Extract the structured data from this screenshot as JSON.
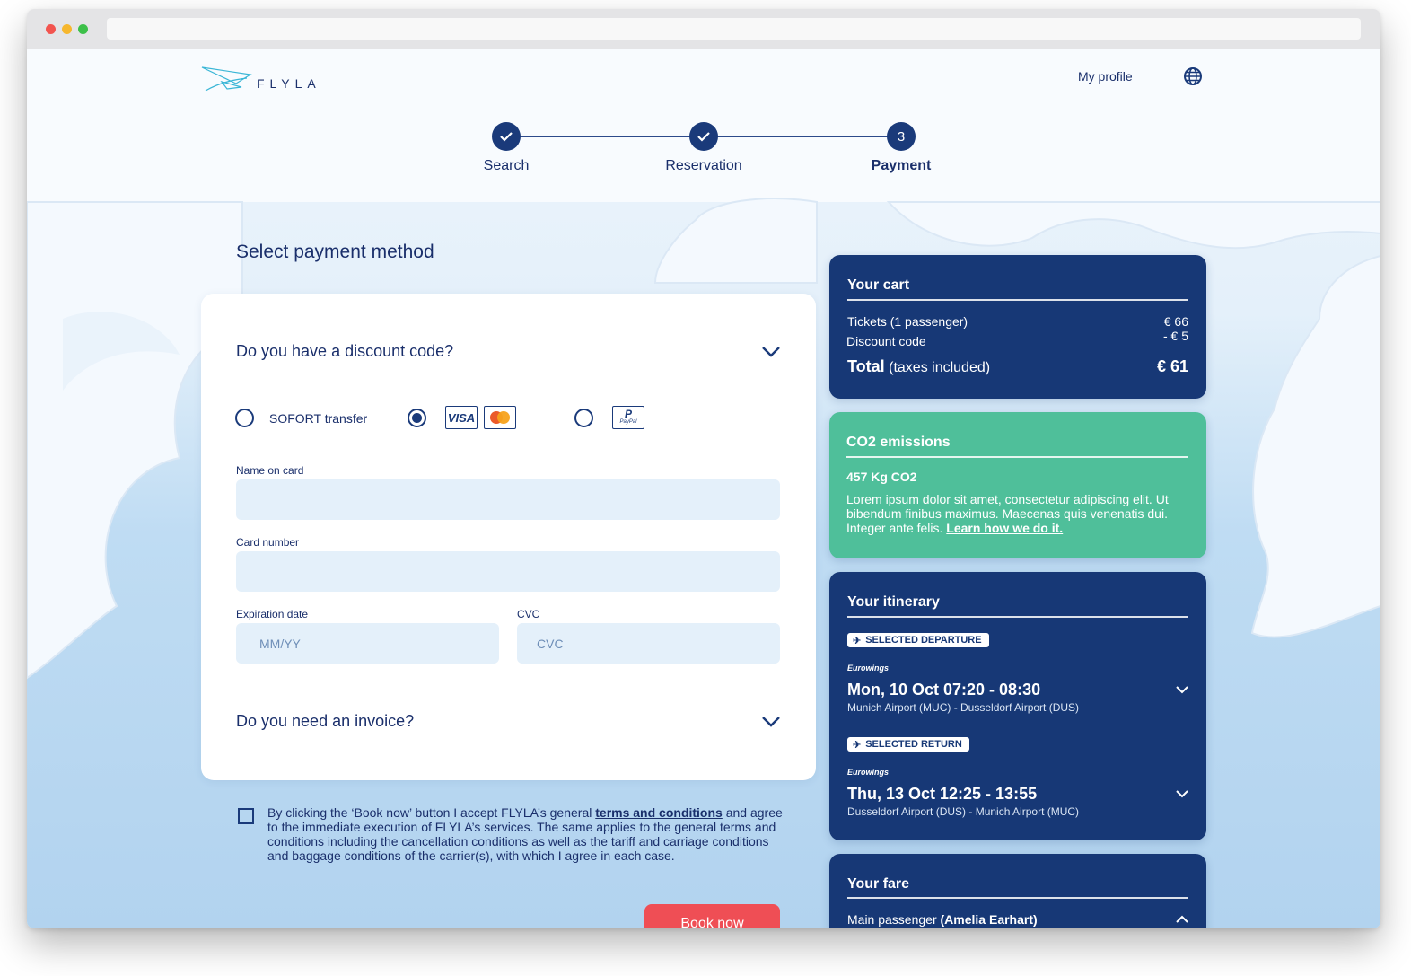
{
  "brand": {
    "name": "FLYLA"
  },
  "header": {
    "profile_label": "My profile",
    "globe_icon": "globe-icon"
  },
  "steps": [
    {
      "label": "Search",
      "state": "done",
      "number": ""
    },
    {
      "label": "Reservation",
      "state": "done",
      "number": ""
    },
    {
      "label": "Payment",
      "state": "current",
      "number": "3"
    }
  ],
  "payment": {
    "section_title": "Select payment method",
    "discount_title": "Do you have a discount code?",
    "methods": [
      {
        "label": "SOFORT transfer",
        "selected": false
      },
      {
        "label": "",
        "selected": true,
        "brands": [
          "VISA",
          "mastercard-logo"
        ]
      },
      {
        "label": "",
        "selected": false,
        "brands": [
          "PayPal"
        ]
      }
    ],
    "fields": {
      "name_label": "Name on card",
      "name_value": "",
      "card_label": "Card number",
      "card_value": "",
      "expiry_label": "Expiration date",
      "expiry_placeholder": "MM/YY",
      "cvc_label": "CVC",
      "cvc_placeholder": "CVC"
    },
    "invoice_title": "Do you need an invoice?"
  },
  "terms": {
    "checked": false,
    "before": "By clicking the ‘Book now’ button I accept FLYLA’s general ",
    "link": "terms and conditions",
    "after": " and agree to the immediate execution of FLYLA’s services. The same applies to the general terms and conditions including the cancellation conditions as well as the tariff and carriage conditions and baggage conditions of the carrier(s), with which I agree in each case."
  },
  "book_label": "Book now",
  "cart": {
    "title": "Your cart",
    "tickets_label": "Tickets",
    "passengers": "(1 passenger)",
    "tickets_price": "€ 66",
    "discount_label": "Discount code",
    "discount_price": "- € 5",
    "total_label": "Total",
    "total_note": "(taxes included)",
    "total_price": "€ 61"
  },
  "co2": {
    "title": "CO2 emissions",
    "amount": "457 Kg CO2",
    "text": "Lorem ipsum dolor sit amet, consectetur adipiscing elit. Ut bibendum finibus maximus. Maecenas quis venenatis dui. Integer ante felis. ",
    "link": "Learn how we do it."
  },
  "itinerary": {
    "title": "Your itinerary",
    "flights": [
      {
        "tag": "SELECTED DEPARTURE",
        "airline": "Eurowings",
        "time": "Mon, 10 Oct 07:20 - 08:30",
        "route": "Munich Airport (MUC) - Dusseldorf Airport (DUS)"
      },
      {
        "tag": "SELECTED RETURN",
        "airline": "Eurowings",
        "time": "Thu, 13 Oct 12:25 - 13:55",
        "route": "Dusseldorf Airport (DUS) - Munich Airport (MUC)"
      }
    ]
  },
  "fare": {
    "title": "Your fare",
    "passenger_label": "Main passenger",
    "passenger_name": "(Amelia Earhart)"
  },
  "colors": {
    "navy": "#173876",
    "green": "#4fbf9a",
    "accent": "#ef4e55",
    "field": "#e4f0fa"
  }
}
